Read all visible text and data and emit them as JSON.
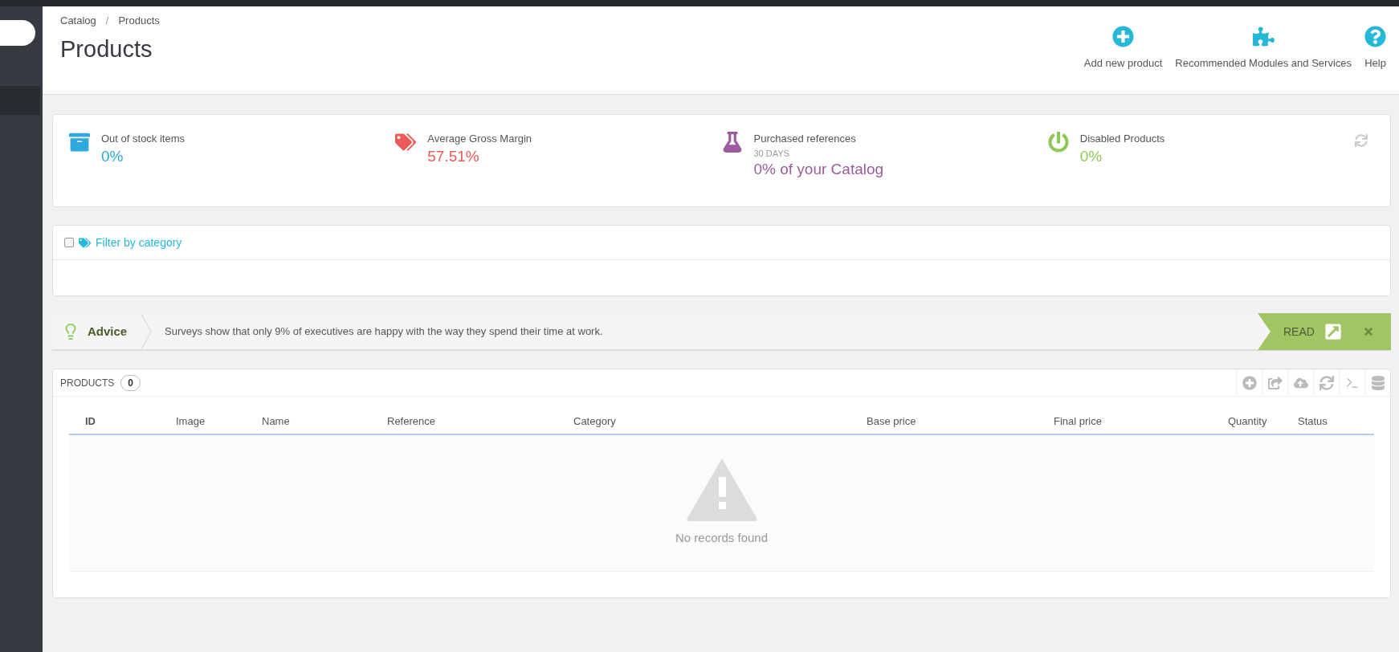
{
  "breadcrumb": [
    "Catalog",
    "Products"
  ],
  "breadcrumb_separator": "/",
  "page_title": "Products",
  "toolbar": [
    {
      "kind": "add",
      "label": "Add new product"
    },
    {
      "kind": "modules",
      "label": "Recommended Modules and Services"
    },
    {
      "kind": "help",
      "label": "Help"
    }
  ],
  "kpis": [
    {
      "kind": "stock",
      "label": "Out of stock items",
      "value": "0%",
      "color": "#2ea8df"
    },
    {
      "kind": "margin",
      "label": "Average Gross Margin",
      "value": "57.51%",
      "color": "#ec5b57"
    },
    {
      "kind": "purchased",
      "label": "Purchased references",
      "sublabel": "30 DAYS",
      "value": "0% of your Catalog",
      "color": "#9c5b9f"
    },
    {
      "kind": "disabled",
      "label": "Disabled Products",
      "value": "0%",
      "color": "#8bc954"
    }
  ],
  "filter": {
    "label": "Filter by category",
    "checked": false
  },
  "advice": {
    "title": "Advice",
    "text": "Surveys show that only 9% of executives are happy with the way they spend their time at work.",
    "action": "READ"
  },
  "products": {
    "title": "PRODUCTS",
    "count": "0",
    "columns": [
      "ID",
      "Image",
      "Name",
      "Reference",
      "Category",
      "Base price",
      "Final price",
      "Quantity",
      "Status"
    ],
    "empty_message": "No records found"
  }
}
